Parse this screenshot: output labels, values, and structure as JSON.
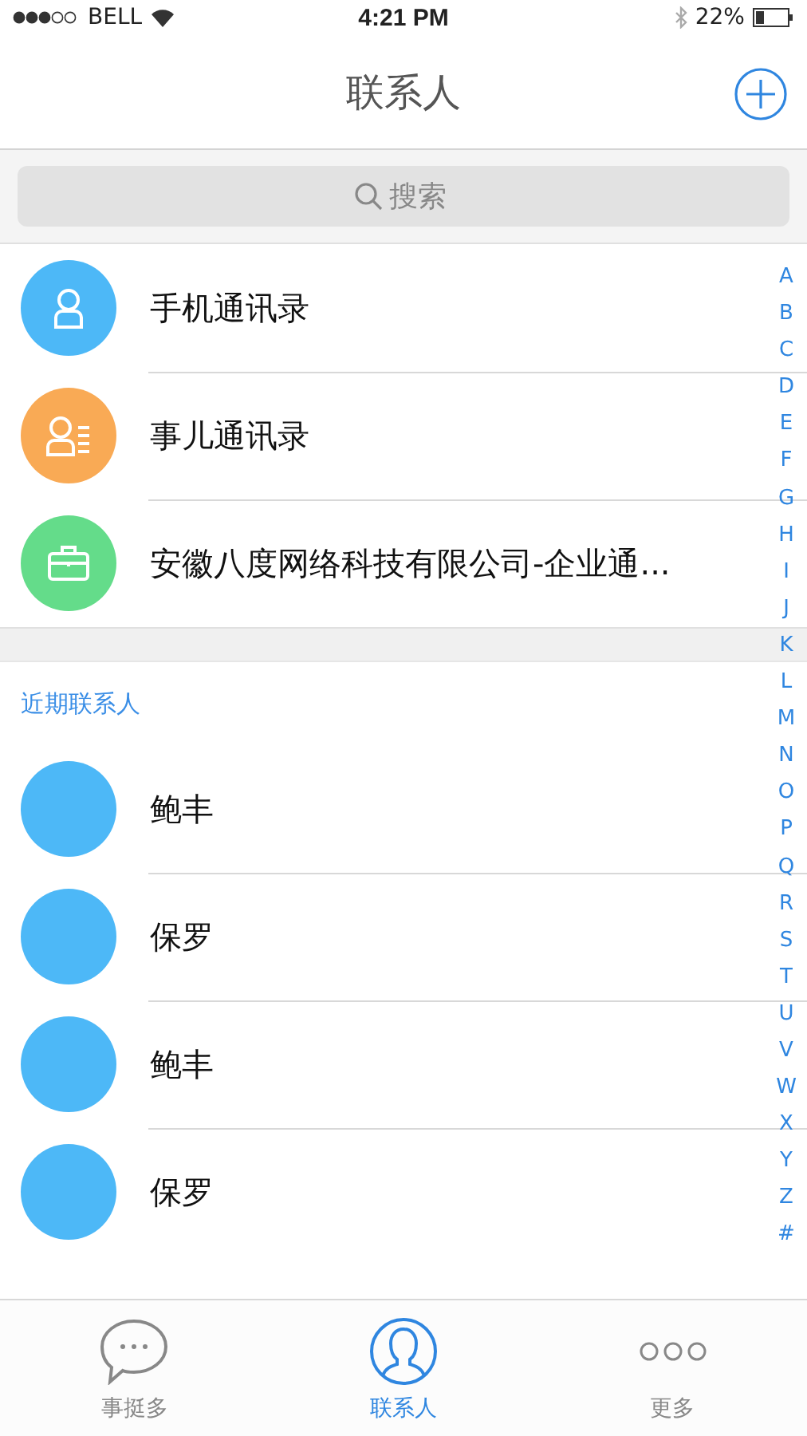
{
  "status_bar": {
    "carrier": "BELL",
    "time": "4:21 PM",
    "battery": "22%"
  },
  "nav": {
    "title": "联系人"
  },
  "search": {
    "placeholder": "搜索"
  },
  "directories": [
    {
      "label": "手机通讯录",
      "kind": "person",
      "color": "#4db8f7"
    },
    {
      "label": "事儿通讯录",
      "kind": "card",
      "color": "#f9aa55"
    },
    {
      "label": "安徽八度网络科技有限公司-企业通...",
      "kind": "briefcase",
      "color": "#64dc8a"
    }
  ],
  "recent": {
    "title": "近期联系人",
    "contacts": [
      {
        "name": "鲍丰"
      },
      {
        "name": "保罗"
      },
      {
        "name": "鲍丰"
      },
      {
        "name": "保罗"
      }
    ]
  },
  "index": [
    "A",
    "B",
    "C",
    "D",
    "E",
    "F",
    "G",
    "H",
    "I",
    "J",
    "K",
    "L",
    "M",
    "N",
    "O",
    "P",
    "Q",
    "R",
    "S",
    "T",
    "U",
    "V",
    "W",
    "X",
    "Y",
    "Z",
    "#"
  ],
  "tabs": [
    {
      "label": "事挺多",
      "kind": "chat",
      "selected": false
    },
    {
      "label": "联系人",
      "kind": "contact",
      "selected": true
    },
    {
      "label": "更多",
      "kind": "more",
      "selected": false
    }
  ]
}
